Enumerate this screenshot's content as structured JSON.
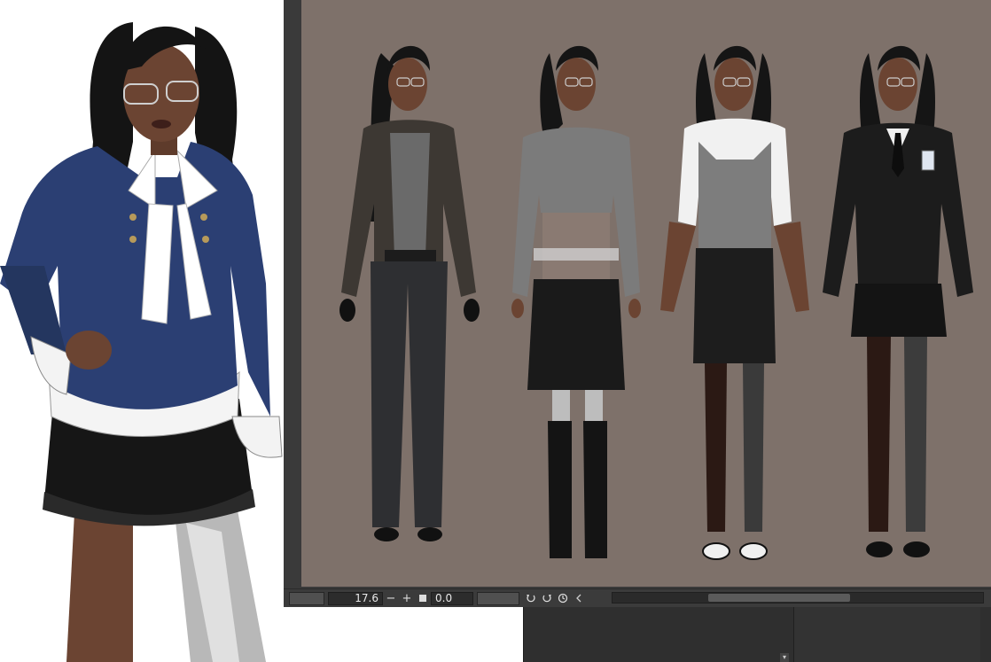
{
  "status_bar": {
    "zoom_value": "17.6",
    "zoom_out_symbol": "−",
    "zoom_in_symbol": "+",
    "rotation_value": "0.0"
  },
  "icons": {
    "zoom_out": "minus-icon",
    "zoom_in": "plus-icon",
    "fit": "square-icon",
    "rotate_left": "rotate-left-icon",
    "rotate_right": "rotate-right-icon",
    "reset_rotation": "reset-rotation-icon",
    "scroll_left": "chevron-left-icon",
    "panel_scroll": "chevron-down-icon"
  },
  "colors": {
    "canvas_background": "#7e716a",
    "ui_dark": "#3a3a3a",
    "jacket_blue": "#2b3f73",
    "skin": "#6b4432",
    "hair": "#151515"
  },
  "figures": [
    "leather-jacket-outfit",
    "knit-top-skirt-outfit",
    "corset-blouse-outfit",
    "pinstripe-suit-outfit"
  ]
}
